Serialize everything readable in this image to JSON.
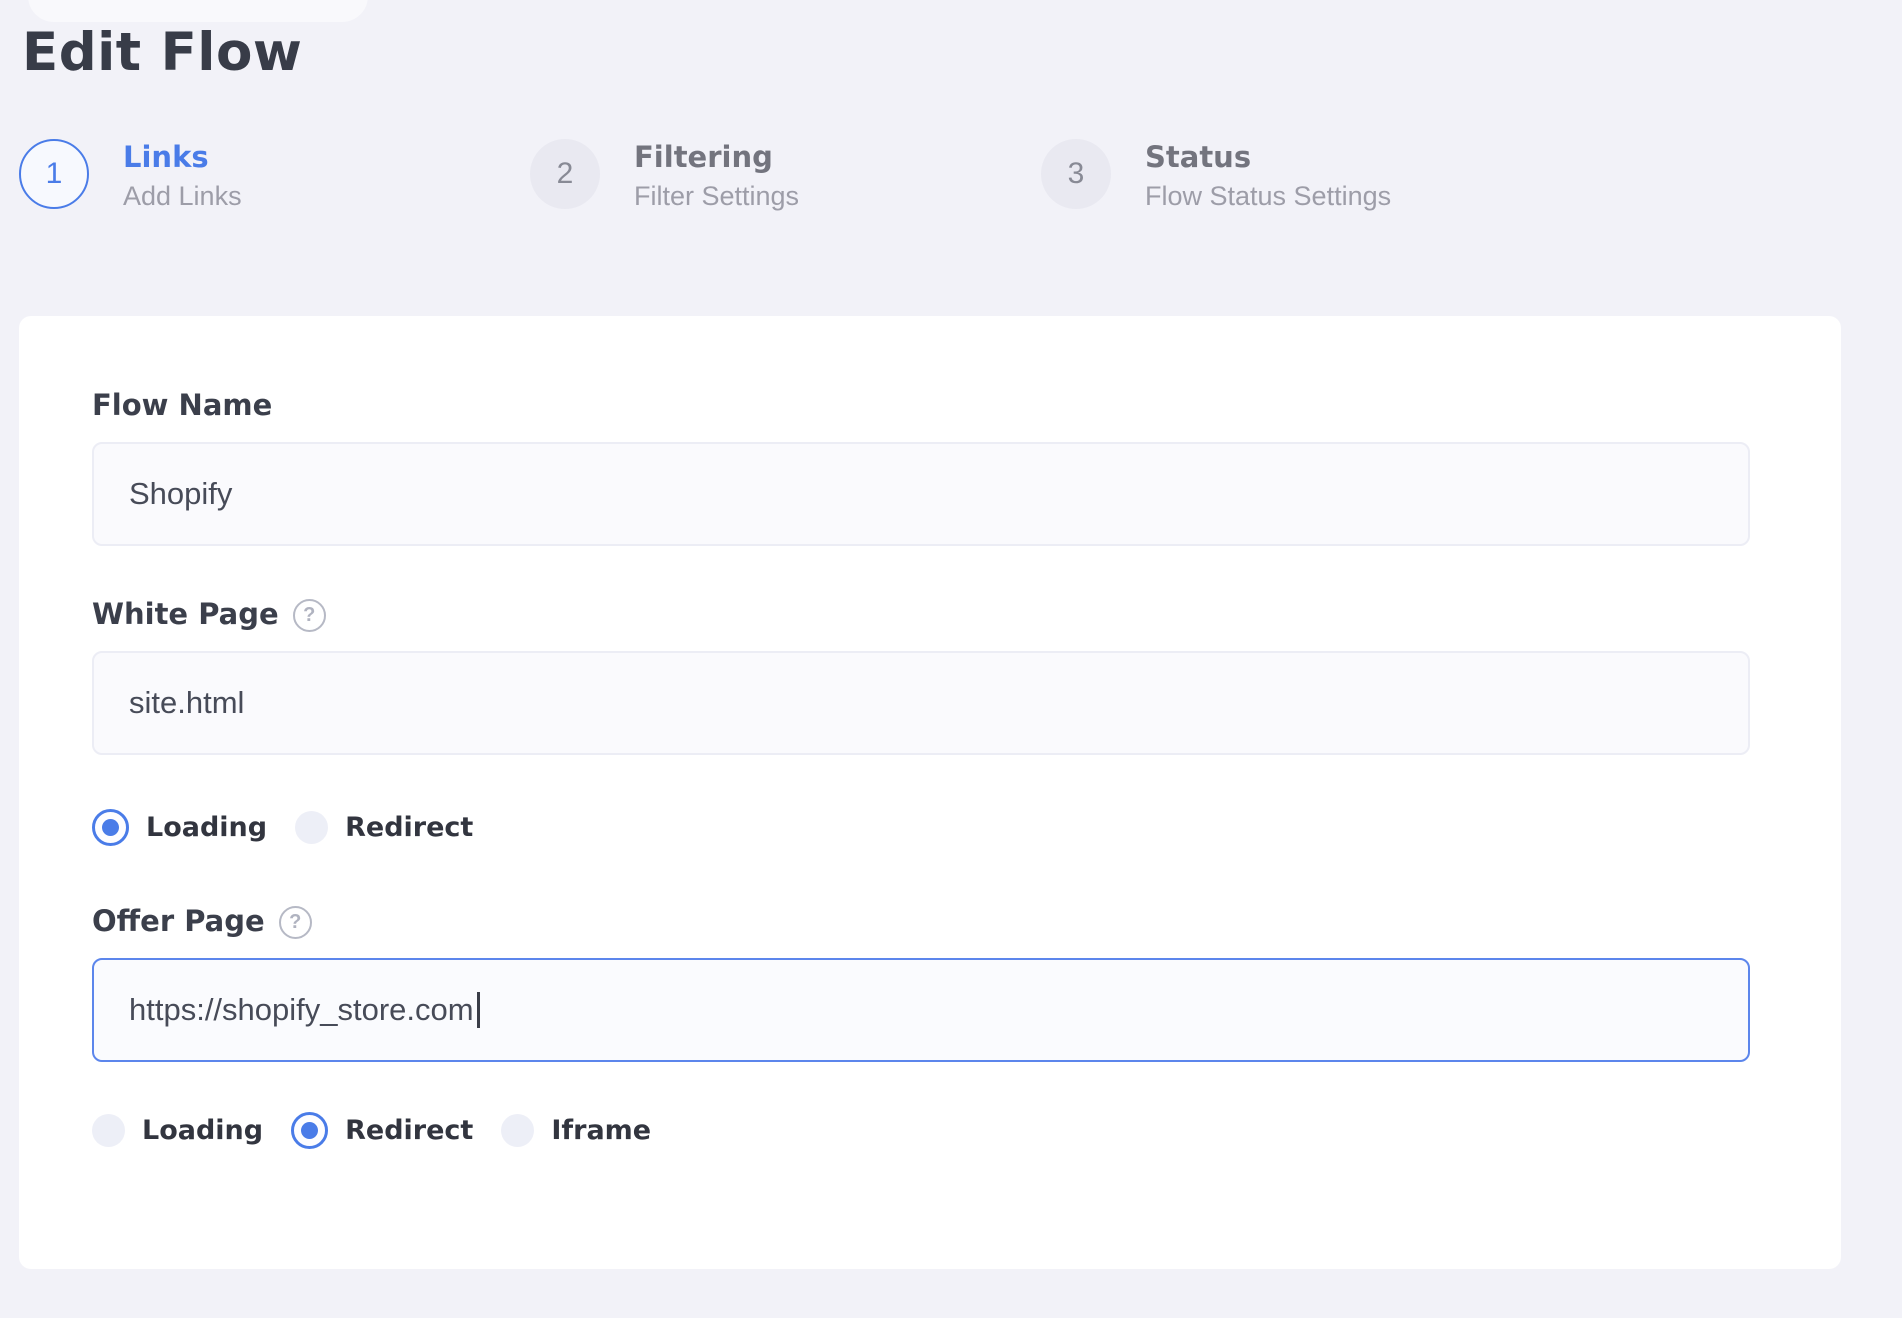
{
  "page": {
    "title": "Edit Flow"
  },
  "stepper": {
    "steps": [
      {
        "number": "1",
        "title": "Links",
        "subtitle": "Add Links",
        "state": "active"
      },
      {
        "number": "2",
        "title": "Filtering",
        "subtitle": "Filter Settings",
        "state": "inactive"
      },
      {
        "number": "3",
        "title": "Status",
        "subtitle": "Flow Status Settings",
        "state": "inactive"
      }
    ]
  },
  "form": {
    "flow_name": {
      "label": "Flow Name",
      "value": "Shopify"
    },
    "white_page": {
      "label": "White Page",
      "help_icon": "?",
      "value": "site.html",
      "mode_options": [
        {
          "label": "Loading",
          "selected": true
        },
        {
          "label": "Redirect",
          "selected": false
        }
      ]
    },
    "offer_page": {
      "label": "Offer Page",
      "help_icon": "?",
      "value": "https://shopify_store.com",
      "focused": true,
      "mode_options": [
        {
          "label": "Loading",
          "selected": false
        },
        {
          "label": "Redirect",
          "selected": true
        },
        {
          "label": "Iframe",
          "selected": false
        }
      ]
    }
  },
  "colors": {
    "accent_blue": "#4a7ce8",
    "focused_border": "#5c86ec",
    "page_background": "#f2f2f8",
    "card_background": "#ffffff",
    "inactive_step_circle": "#e9e9f1",
    "input_background": "#fafafd",
    "input_border": "#ecedf5",
    "label_text": "#3b3f4b",
    "muted_text": "#9d9da8"
  }
}
